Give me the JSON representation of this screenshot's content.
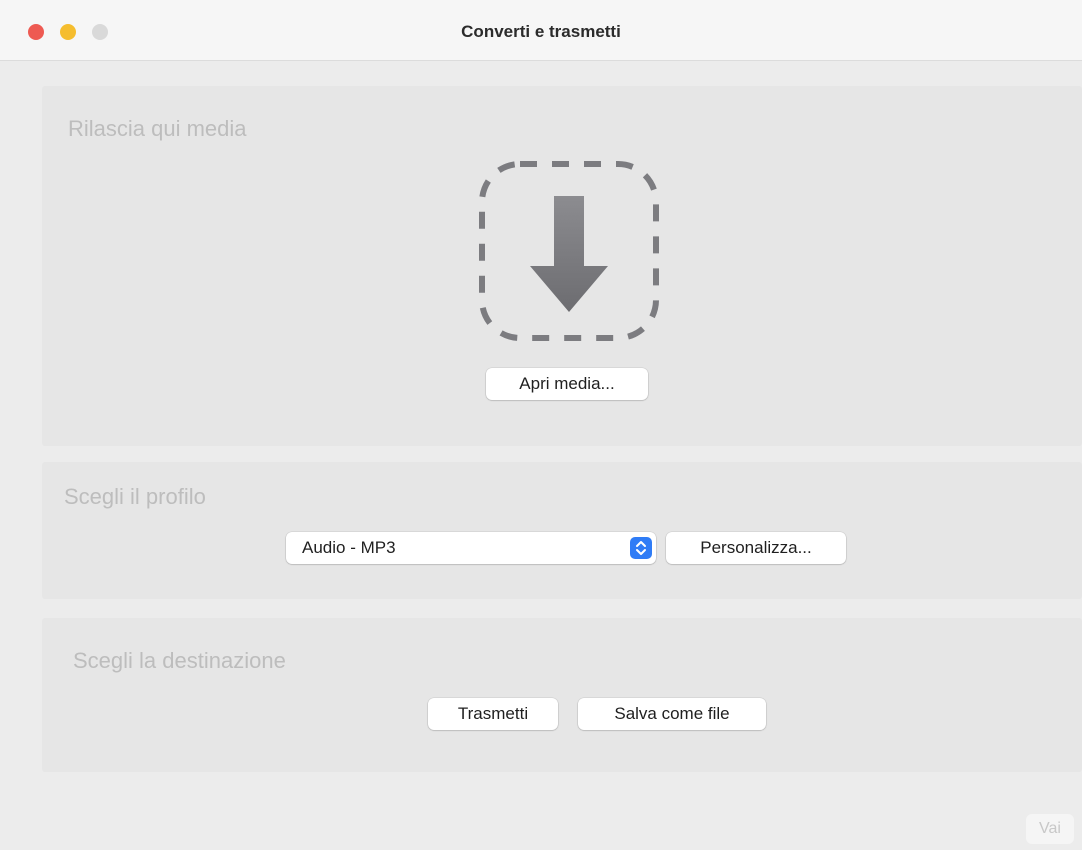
{
  "window": {
    "title": "Converti e trasmetti"
  },
  "drop_panel": {
    "title": "Rilascia qui media",
    "open_button": "Apri media...",
    "icon": "download-arrow-icon"
  },
  "profile_panel": {
    "title": "Scegli il profilo",
    "selected_profile": "Audio - MP3",
    "customize_button": "Personalizza..."
  },
  "destination_panel": {
    "title": "Scegli la destinazione",
    "stream_button": "Trasmetti",
    "save_button": "Salva come file"
  },
  "footer": {
    "go_button": "Vai"
  },
  "colors": {
    "close": "#ee5a52",
    "minimize": "#f5bd2e",
    "maximize": "#d9d9d9",
    "accent": "#2f7cf6",
    "panel": "#e6e6e6",
    "window": "#ececec"
  }
}
